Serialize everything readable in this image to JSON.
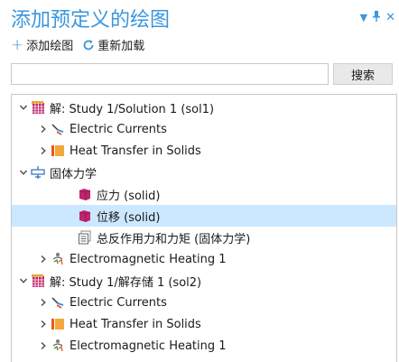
{
  "panel": {
    "title": "添加预定义的绘图",
    "menu_icon": "dropdown-arrow-icon",
    "pin_icon": "pin-icon",
    "close_icon": "close-icon"
  },
  "toolbar": {
    "add_plot_label": "添加绘图",
    "reload_label": "重新加载"
  },
  "search": {
    "value": "",
    "placeholder": "",
    "button_label": "搜索"
  },
  "tree": [
    {
      "label": "解: Study 1/Solution 1 (sol1)",
      "icon": "solution-grid-icon",
      "expanded": true
    },
    {
      "label": "Electric Currents",
      "icon": "electric-currents-icon",
      "expanded": false
    },
    {
      "label": "Heat Transfer in Solids",
      "icon": "heat-transfer-icon",
      "expanded": false
    },
    {
      "label": "固体力学",
      "icon": "solid-mechanics-icon",
      "expanded": true
    },
    {
      "label": "应力 (solid)",
      "icon": "volume-plot-icon"
    },
    {
      "label": "位移 (solid)",
      "icon": "volume-plot-icon",
      "selected": true
    },
    {
      "label": "总反作用力和力矩 (固体力学)",
      "icon": "evaluation-table-icon"
    },
    {
      "label": "Electromagnetic Heating 1",
      "icon": "electromagnetic-heating-icon",
      "expanded": false
    },
    {
      "label": "解: Study 1/解存储 1 (sol2)",
      "icon": "solution-grid-icon",
      "expanded": true
    },
    {
      "label": "Electric Currents",
      "icon": "electric-currents-icon",
      "expanded": false
    },
    {
      "label": "Heat Transfer in Solids",
      "icon": "heat-transfer-icon",
      "expanded": false
    },
    {
      "label": "Electromagnetic Heating 1",
      "icon": "electromagnetic-heating-icon",
      "expanded": false
    }
  ],
  "colors": {
    "accent": "#3a96dd",
    "selection": "#cce8ff"
  }
}
